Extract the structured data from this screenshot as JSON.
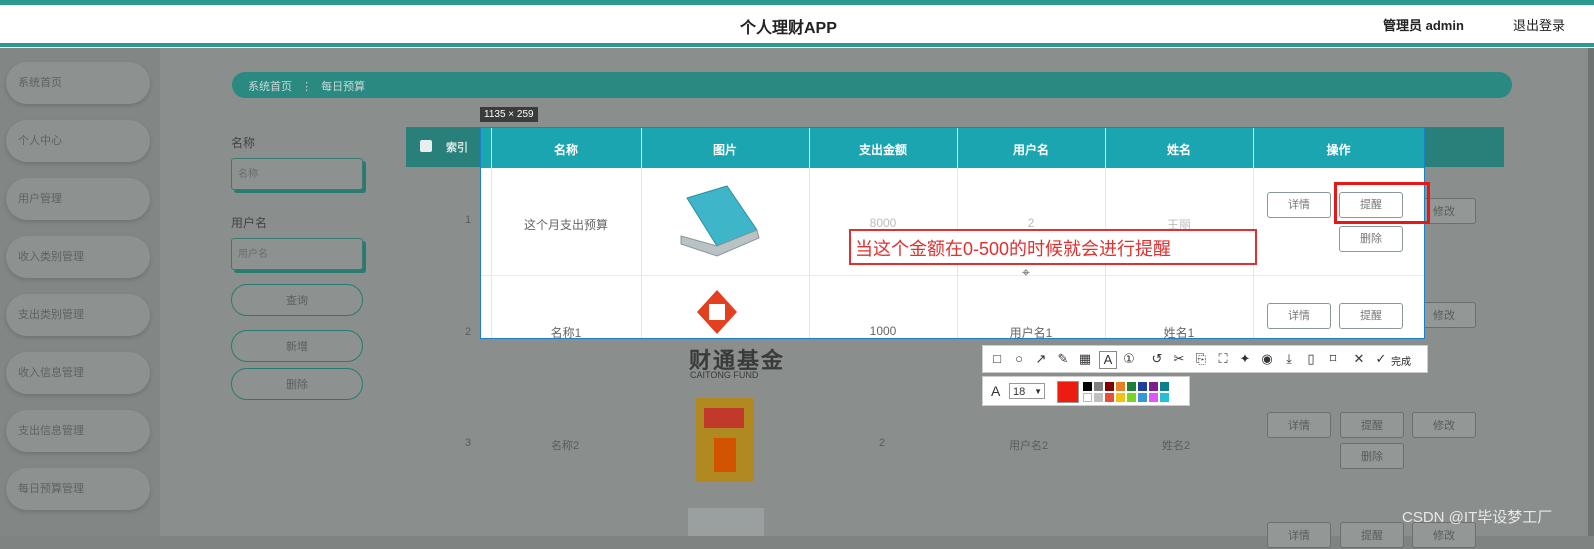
{
  "header": {
    "title": "个人理财APP",
    "user": "管理员 admin",
    "logout": "退出登录"
  },
  "sidebar": {
    "items": [
      "系统首页",
      "个人中心",
      "用户管理",
      "收入类别管理",
      "支出类别管理",
      "收入信息管理",
      "支出信息管理",
      "每日预算管理"
    ]
  },
  "breadcrumb": {
    "home": "系统首页",
    "sep": "⋮",
    "current": "每日预算"
  },
  "filters": {
    "name_label": "名称",
    "name_placeholder": "名称",
    "user_label": "用户名",
    "user_placeholder": "用户名",
    "query": "查询",
    "add": "新增",
    "delete": "删除"
  },
  "table": {
    "headers": [
      "索引",
      "名称",
      "图片",
      "支出金额",
      "用户名",
      "姓名",
      "操作"
    ],
    "rows": [
      {
        "index": "1",
        "name": "这个月支出预算",
        "amount": "8000",
        "user": "2",
        "realname": "王丽"
      },
      {
        "index": "2",
        "name": "名称1",
        "amount": "1000",
        "user": "用户名1",
        "realname": "姓名1"
      },
      {
        "index": "3",
        "name": "名称2",
        "amount": "2",
        "user": "用户名2",
        "realname": "姓名2"
      }
    ],
    "actions": {
      "detail": "详情",
      "remind": "提醒",
      "edit": "修改",
      "remove": "删除"
    }
  },
  "capture": {
    "size": "1135 × 259",
    "annotation": "当这个金额在0-500的时候就会进行提醒",
    "font_size": "18",
    "done": "完成",
    "logo_text_cn": "财通基金",
    "logo_text_en": "CAITONG FUND"
  },
  "watermark": "CSDN @IT毕设梦工厂",
  "colors": {
    "accent": "#1ba5b1",
    "annotation": "#e03030",
    "header_stripe": "#2a9a8f"
  }
}
